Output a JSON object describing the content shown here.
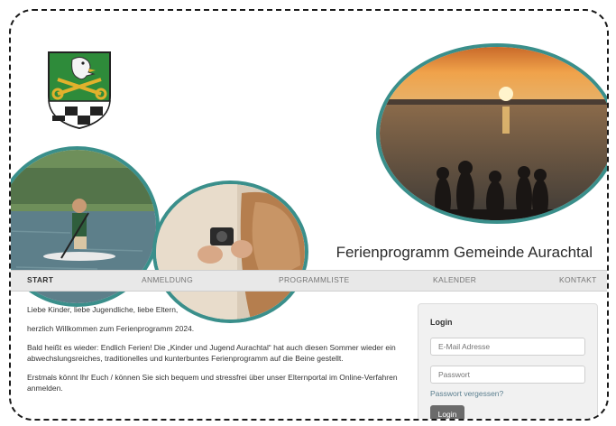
{
  "header": {
    "site_title": "Ferienprogramm Gemeinde Aurachtal"
  },
  "nav": {
    "items": [
      {
        "label": "START",
        "active": true
      },
      {
        "label": "ANMELDUNG",
        "active": false
      },
      {
        "label": "PROGRAMMLISTE",
        "active": false
      },
      {
        "label": "KALENDER",
        "active": false
      },
      {
        "label": "KONTAKT",
        "active": false
      }
    ]
  },
  "content": {
    "paragraphs": [
      "Liebe Kinder, liebe Jugendliche, liebe Eltern,",
      "herzlich Willkommen zum Ferienprogramm 2024.",
      "Bald heißt es wieder: Endlich Ferien! Die „Kinder und Jugend Aurachtal“ hat auch diesen Sommer wieder ein abwechslungsreiches, traditionelles und kunterbuntes Ferienprogramm auf die Beine gestellt.",
      "Erstmals könnt Ihr Euch / können Sie sich bequem und stressfrei über unser Elternportal im Online-Verfahren anmelden."
    ]
  },
  "login": {
    "title": "Login",
    "email_placeholder": "E-Mail Adresse",
    "password_placeholder": "Passwort",
    "forgot_label": "Passwort vergessen?",
    "button_label": "Login"
  },
  "colors": {
    "accent": "#3a8f8b",
    "nav_bg": "#e8e8e8",
    "button_bg": "#6b6b6b"
  }
}
